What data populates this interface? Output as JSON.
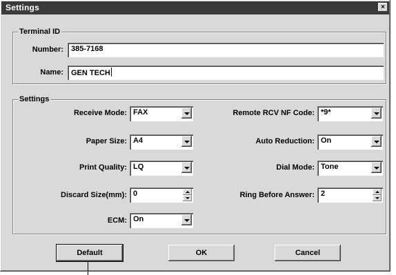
{
  "window": {
    "title": "Settings",
    "close_glyph": "×"
  },
  "terminal_group": {
    "legend": "Terminal ID",
    "number_label": "Number:",
    "number_value": "385-7168",
    "name_label": "Name:",
    "name_value": "GEN TECH"
  },
  "settings_group": {
    "legend": "Settings",
    "receive_mode": {
      "label": "Receive Mode:",
      "value": "FAX"
    },
    "paper_size": {
      "label": "Paper Size:",
      "value": "A4"
    },
    "print_quality": {
      "label": "Print Quality:",
      "value": "LQ"
    },
    "discard_size": {
      "label": "Discard Size(mm):",
      "value": "0"
    },
    "ecm": {
      "label": "ECM:",
      "value": "On"
    },
    "remote_rcv": {
      "label": "Remote RCV NF Code:",
      "value": "*9*"
    },
    "auto_reduction": {
      "label": "Auto Reduction:",
      "value": "On"
    },
    "dial_mode": {
      "label": "Dial Mode:",
      "value": "Tone"
    },
    "ring_before_answer": {
      "label": "Ring Before Answer:",
      "value": "2"
    }
  },
  "buttons": {
    "default_label": "Default",
    "ok_label": "OK",
    "cancel_label": "Cancel"
  },
  "icons": {
    "dropdown": "chevron-down-icon",
    "spin_up": "spin-up-icon",
    "spin_down": "spin-down-icon",
    "close": "close-icon"
  }
}
